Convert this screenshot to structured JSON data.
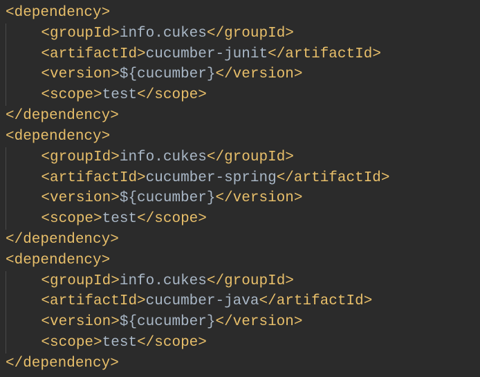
{
  "tags": {
    "dep_open": "<dependency>",
    "dep_close": "</dependency>",
    "gid_open": "<groupId>",
    "gid_close": "</groupId>",
    "aid_open": "<artifactId>",
    "aid_close": "</artifactId>",
    "ver_open": "<version>",
    "ver_close": "</version>",
    "scope_open": "<scope>",
    "scope_close": "</scope>"
  },
  "dependencies": [
    {
      "groupId": "info.cukes",
      "artifactId": "cucumber-junit",
      "version": "${cucumber}",
      "scope": "test"
    },
    {
      "groupId": "info.cukes",
      "artifactId": "cucumber-spring",
      "version": "${cucumber}",
      "scope": "test"
    },
    {
      "groupId": "info.cukes",
      "artifactId": "cucumber-java",
      "version": "${cucumber}",
      "scope": "test"
    }
  ]
}
